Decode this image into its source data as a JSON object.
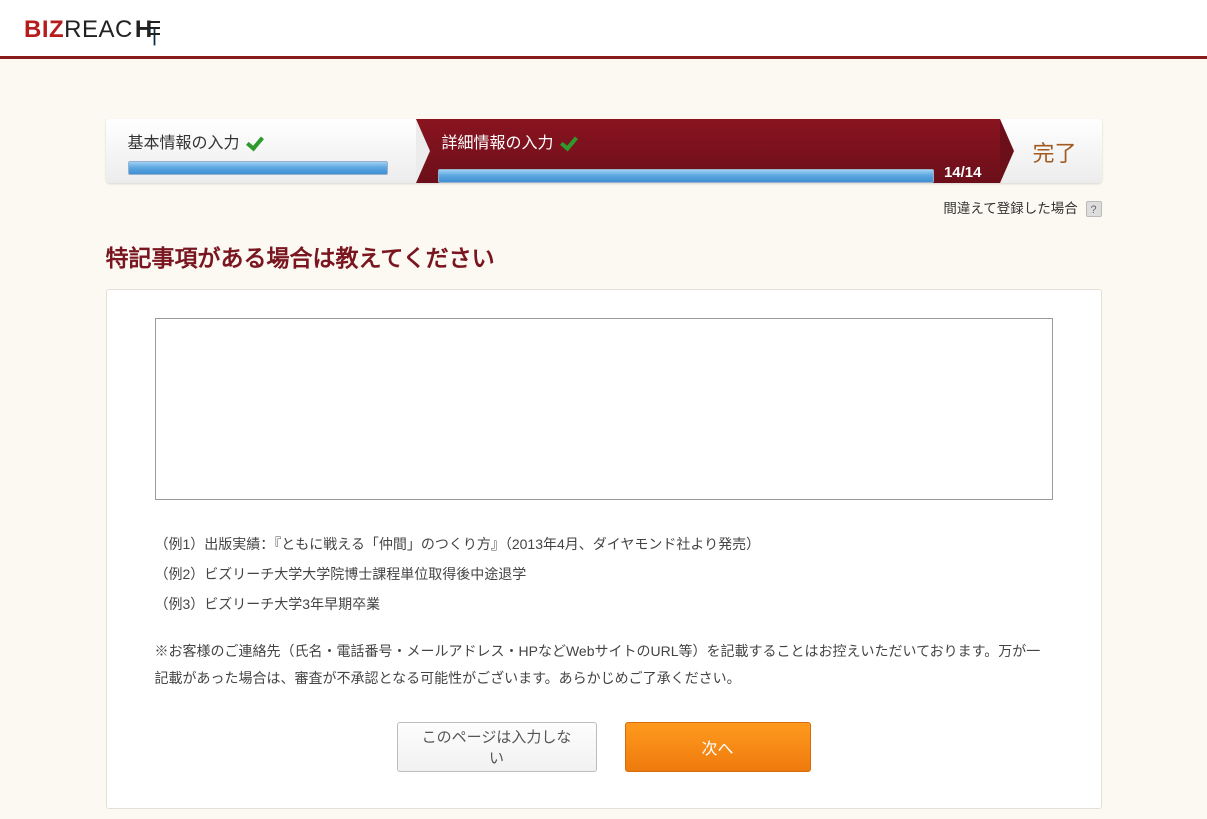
{
  "brand": {
    "part1": "BIZ",
    "part2": "REAC"
  },
  "progress": {
    "step1": {
      "label": "基本情報の入力"
    },
    "step2": {
      "label": "詳細情報の入力",
      "counter": "14/14"
    },
    "step3": {
      "label": "完了"
    }
  },
  "help": {
    "text": "間違えて登録した場合",
    "mark": "?"
  },
  "title": "特記事項がある場合は教えてください",
  "form": {
    "notes_value": "",
    "notes_placeholder": ""
  },
  "examples": {
    "e1": "（例1）出版実績：『ともに戦える「仲間」のつくり方』（2013年4月、ダイヤモンド社より発売）",
    "e2": "（例2）ビズリーチ大学大学院博士課程単位取得後中途退学",
    "e3": "（例3）ビズリーチ大学3年早期卒業"
  },
  "note": "※お客様のご連絡先（氏名・電話番号・メールアドレス・HPなどWebサイトのURL等）を記載することはお控えいただいております。万が一記載があった場合は、審査が不承認となる可能性がございます。あらかじめご了承ください。",
  "buttons": {
    "skip": "このページは入力しない",
    "next": "次へ"
  }
}
